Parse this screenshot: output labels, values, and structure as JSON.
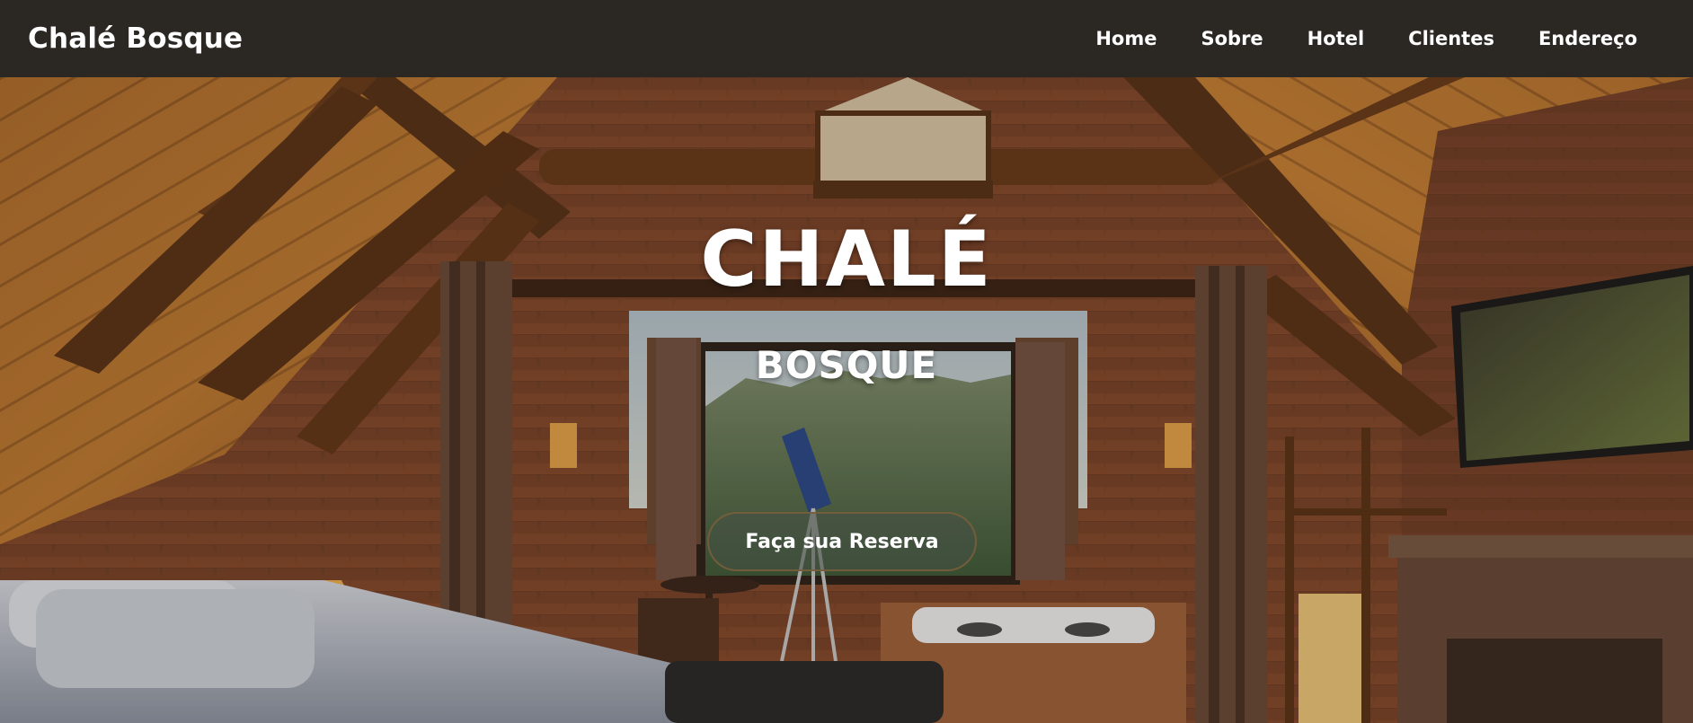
{
  "navbar": {
    "brand": "Chalé Bosque",
    "links": [
      {
        "label": "Home"
      },
      {
        "label": "Sobre"
      },
      {
        "label": "Hotel"
      },
      {
        "label": "Clientes"
      },
      {
        "label": "Endereço"
      }
    ]
  },
  "hero": {
    "title": "CHALÉ",
    "subtitle": "BOSQUE",
    "cta_label": "Faça sua Reserva",
    "image_description_icon": "cabin-interior-photo"
  },
  "colors": {
    "navbar_bg": "#2b2723",
    "nav_text": "#ffffff",
    "hero_text": "#ffffff"
  }
}
